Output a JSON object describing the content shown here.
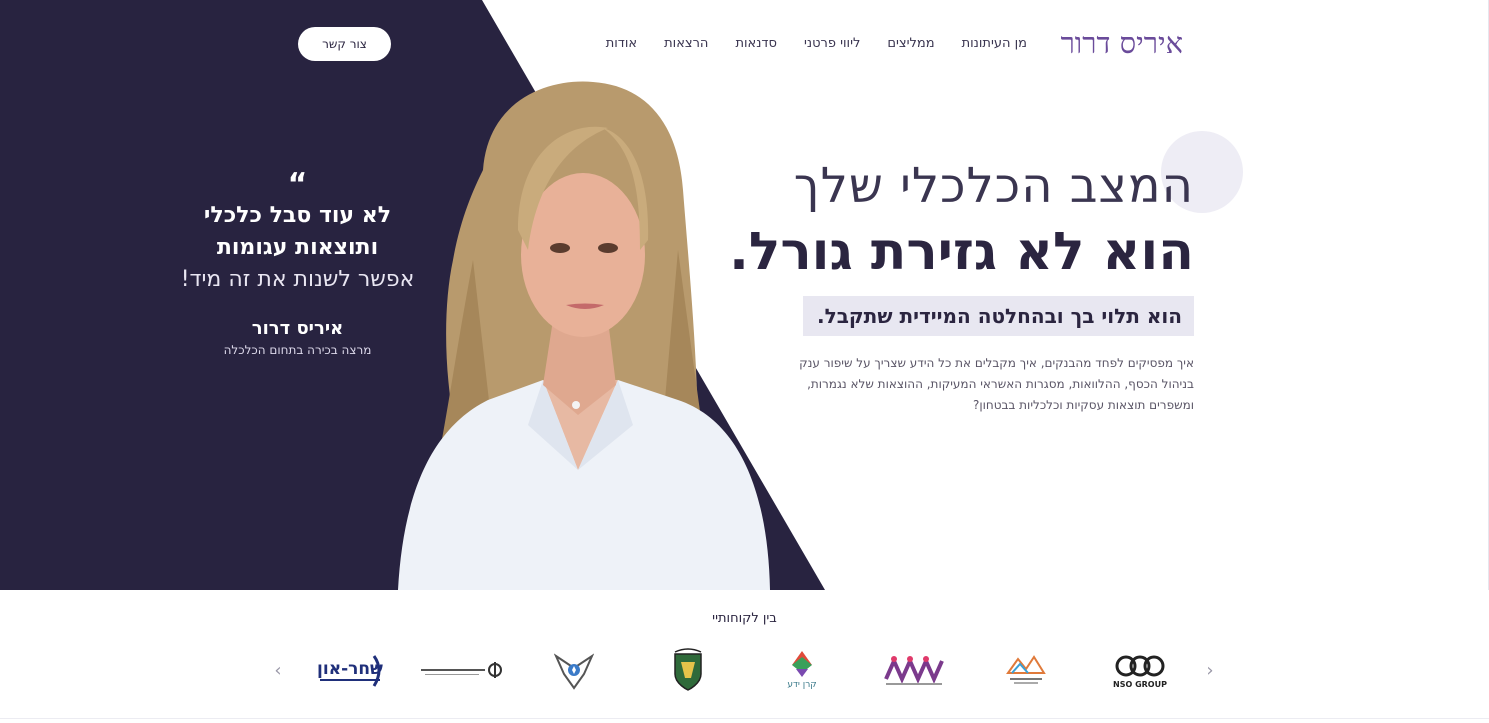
{
  "header": {
    "logo": "איריס דרור",
    "nav": [
      "אודות",
      "הרצאות",
      "סדנאות",
      "ליווי פרטני",
      "ממליצים",
      "מן העיתונות"
    ],
    "contact_label": "צור קשר"
  },
  "hero": {
    "headline_line1": "המצב הכלכלי שלך",
    "headline_line2": "הוא לא גזירת גורל.",
    "highlight": "הוא תלוי בך ובהחלטה המיידית שתקבל.",
    "description": "איך מפסיקים לפחד מהבנקים, איך מקבלים את כל הידע שצריך על שיפור ענק בניהול הכסף, ההלוואות, מסגרות האשראי המעיקות, ההוצאות שלא נגמרות, ומשפרים תוצאות עסקיות וכלכליות בבטחון?",
    "quote": {
      "mark": "“",
      "line1": "לא עוד סבל כלכלי",
      "line2": "ותוצאות עגומות",
      "line3": "אפשר לשנות את זה מיד!",
      "name": "איריס דרור",
      "role": "מרצה בכירה בתחום הכלכלה"
    },
    "colors": {
      "dark_bg": "#282340",
      "accent": "#6a4b9a",
      "highlight_bg": "#e8e7f1"
    }
  },
  "clients": {
    "title": "בין לקוחותיי",
    "prev_icon": "chevron-left-icon",
    "next_icon": "chevron-right-icon",
    "logos": [
      {
        "name": "nso-group-logo",
        "text": "NSO GROUP"
      },
      {
        "name": "client-logo-mountains",
        "text": ""
      },
      {
        "name": "client-logo-figures",
        "text": ""
      },
      {
        "name": "keren-yeda-logo",
        "text": "קרן ידע"
      },
      {
        "name": "client-logo-emblem",
        "text": ""
      },
      {
        "name": "air-force-logo",
        "text": ""
      },
      {
        "name": "client-logo-institute",
        "text": ""
      },
      {
        "name": "shahar-on-logo",
        "text": "שחר-און"
      }
    ]
  }
}
